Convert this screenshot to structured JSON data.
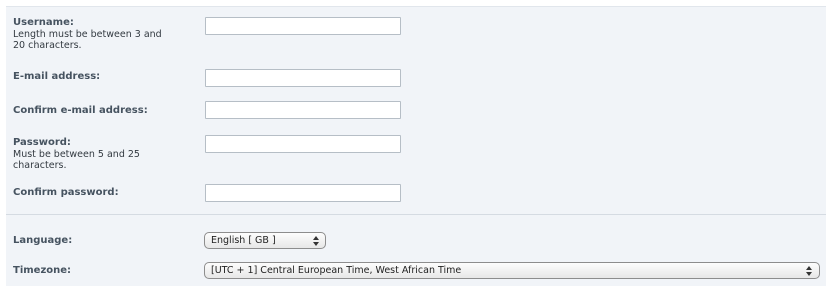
{
  "form": {
    "username": {
      "label": "Username:",
      "description": "Length must be between 3 and 20 characters.",
      "value": ""
    },
    "email": {
      "label": "E-mail address:",
      "value": ""
    },
    "confirm_email": {
      "label": "Confirm e-mail address:",
      "value": ""
    },
    "password": {
      "label": "Password:",
      "description": "Must be between 5 and 25 characters.",
      "value": ""
    },
    "confirm_password": {
      "label": "Confirm password:",
      "value": ""
    },
    "language": {
      "label": "Language:",
      "selected": "English [ GB ]"
    },
    "timezone": {
      "label": "Timezone:",
      "selected": "[UTC + 1] Central European Time, West African Time"
    }
  },
  "icons": {
    "select_arrows": "updown-arrows-icon"
  }
}
